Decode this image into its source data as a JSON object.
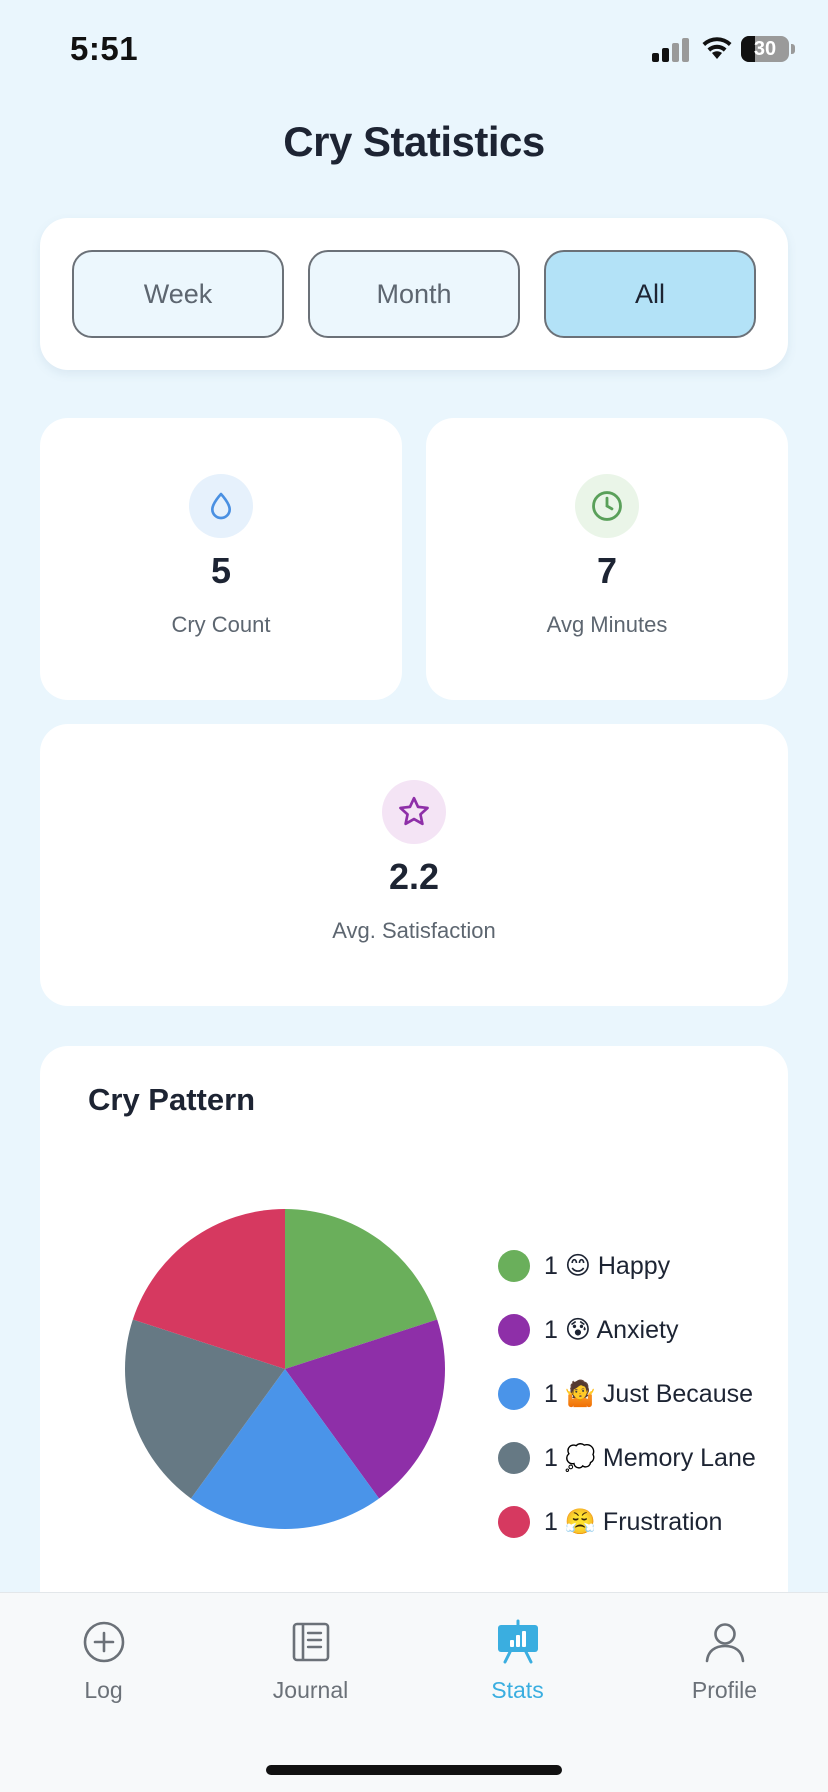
{
  "status_bar": {
    "time": "5:51",
    "battery_level": "30"
  },
  "page": {
    "title": "Cry Statistics"
  },
  "filters": {
    "week_label": "Week",
    "month_label": "Month",
    "all_label": "All",
    "selected": "All"
  },
  "stats": {
    "cry_count": {
      "value": "5",
      "label": "Cry Count",
      "icon": "droplet-icon",
      "color": "#4a90e2"
    },
    "avg_minutes": {
      "value": "7",
      "label": "Avg Minutes",
      "icon": "clock-icon",
      "color": "#5aa05a"
    },
    "avg_satisfaction": {
      "value": "2.2",
      "label": "Avg. Satisfaction",
      "icon": "star-icon",
      "color": "#8e2fa8"
    }
  },
  "chart": {
    "title": "Cry Pattern"
  },
  "chart_data": {
    "type": "pie",
    "title": "Cry Pattern",
    "legend_position": "right",
    "slices": [
      {
        "label": "Happy",
        "emoji": "😊",
        "value": 1,
        "color": "#6aaf5b"
      },
      {
        "label": "Anxiety",
        "emoji": "😰",
        "value": 1,
        "color": "#8e2fa8"
      },
      {
        "label": "Just Because",
        "emoji": "🤷",
        "value": 1,
        "color": "#4a94e9"
      },
      {
        "label": "Memory Lane",
        "emoji": "💭",
        "value": 1,
        "color": "#667984"
      },
      {
        "label": "Frustration",
        "emoji": "😤",
        "value": 1,
        "color": "#d63960"
      }
    ]
  },
  "tabs": [
    {
      "label": "Log",
      "icon": "plus-circle-icon",
      "active": false
    },
    {
      "label": "Journal",
      "icon": "journal-icon",
      "active": false
    },
    {
      "label": "Stats",
      "icon": "stats-presentation-icon",
      "active": true
    },
    {
      "label": "Profile",
      "icon": "person-icon",
      "active": false
    }
  ],
  "colors": {
    "background": "#eaf6fd",
    "accent": "#3aaee0",
    "active_filter": "#b3e2f7"
  }
}
